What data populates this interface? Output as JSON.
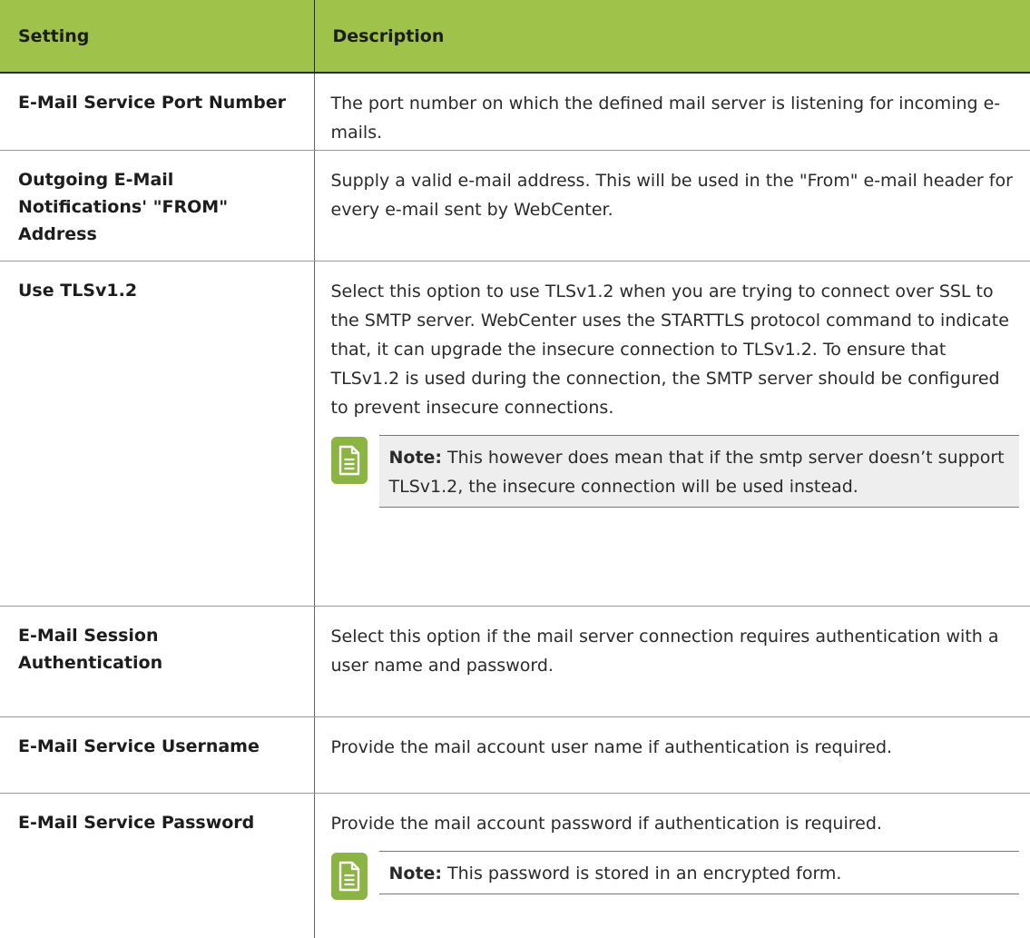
{
  "table": {
    "headers": [
      "Setting",
      "Description"
    ],
    "rows": [
      {
        "setting": "E-Mail Service Port Number",
        "description": "The port number on which the defined mail server is listening for incoming e-mails."
      },
      {
        "setting": "Outgoing E-Mail Notifications' \"FROM\" Address",
        "description": "Supply a valid e-mail address. This will be used in the \"From\" e-mail header for every e-mail sent by WebCenter."
      },
      {
        "setting": "Use TLSv1.2",
        "description": "Select this option to use TLSv1.2 when you are trying to connect over SSL to the SMTP server. WebCenter uses the STARTTLS protocol command to indicate that, it can upgrade the insecure connection to TLSv1.2. To ensure that TLSv1.2 is used during the connection, the SMTP server should be configured to prevent insecure connections.",
        "note_label": "Note:",
        "note_text": "This however does mean that if the smtp server doesn’t support TLSv1.2, the insecure connection will be used instead."
      },
      {
        "setting": "E-Mail Session Authentication",
        "description": "Select this option if the mail server connection requires authentication with a user name and password."
      },
      {
        "setting": "E-Mail Service Username",
        "description": "Provide the mail account user name if authentication is required."
      },
      {
        "setting": "E-Mail Service Password",
        "description": "Provide the mail account password if authentication is required.",
        "note_label": "Note:",
        "note_text": "This password is stored in an encrypted form."
      }
    ]
  },
  "icons": {
    "note": "note-document-icon"
  },
  "colors": {
    "header_bg": "#9fc24a",
    "note_icon_bg": "#8bb443",
    "note_bg": "#eeeeee"
  }
}
